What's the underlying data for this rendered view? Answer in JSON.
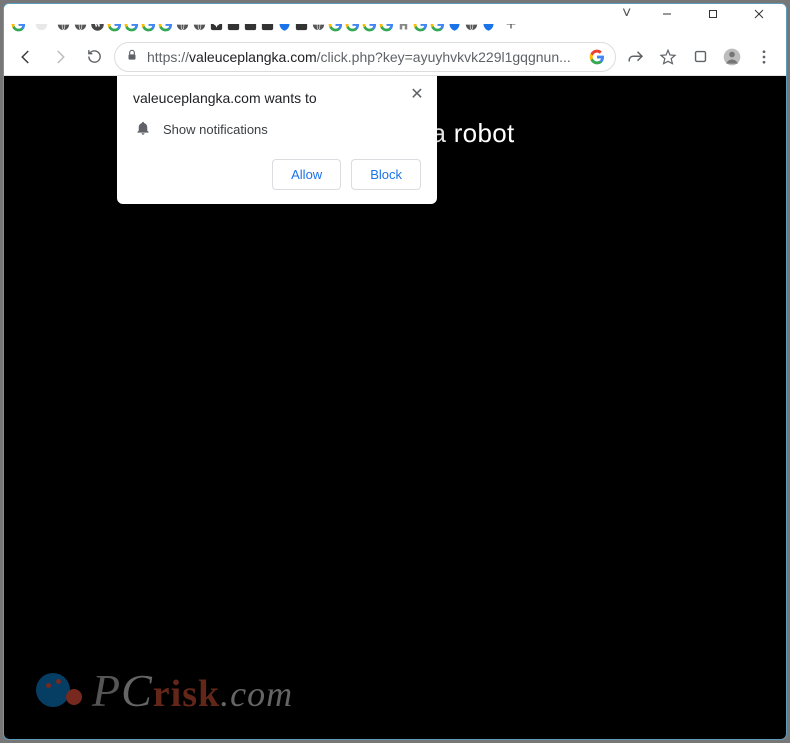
{
  "window": {
    "controls": {
      "min": "–",
      "max": "▢",
      "close": "✕",
      "chev": "˅"
    }
  },
  "tabs": {
    "items": [
      {
        "name": "google-icon"
      },
      {
        "name": "blank-active"
      },
      {
        "name": "globe-icon"
      },
      {
        "name": "globe-icon"
      },
      {
        "name": "wordpress-icon"
      },
      {
        "name": "google-icon"
      },
      {
        "name": "google-icon"
      },
      {
        "name": "google-icon"
      },
      {
        "name": "google-icon"
      },
      {
        "name": "globe-icon"
      },
      {
        "name": "globe-icon"
      },
      {
        "name": "sparkle-icon"
      },
      {
        "name": "square-icon"
      },
      {
        "name": "square-icon"
      },
      {
        "name": "square-icon"
      },
      {
        "name": "shield-icon"
      },
      {
        "name": "square-icon"
      },
      {
        "name": "globe-icon"
      },
      {
        "name": "google-icon"
      },
      {
        "name": "google-icon"
      },
      {
        "name": "google-icon"
      },
      {
        "name": "google-icon"
      },
      {
        "name": "home-icon"
      },
      {
        "name": "google-icon"
      },
      {
        "name": "google-icon"
      },
      {
        "name": "shield-icon"
      },
      {
        "name": "globe-icon"
      },
      {
        "name": "shield-icon"
      }
    ],
    "newtab": "+"
  },
  "omnibox": {
    "protocol": "https://",
    "host": "valeuceplangka.com",
    "path": "/click.php?key=ayuyhvkvk229l1gqgnun..."
  },
  "page": {
    "heading": "t you are not a robot"
  },
  "notification": {
    "title": "valeuceplangka.com wants to",
    "line": "Show notifications",
    "allow": "Allow",
    "block": "Block",
    "close": "✕"
  },
  "watermark": {
    "p": "P",
    "c": "C",
    "risk": "risk",
    "dotcom": ".com"
  }
}
